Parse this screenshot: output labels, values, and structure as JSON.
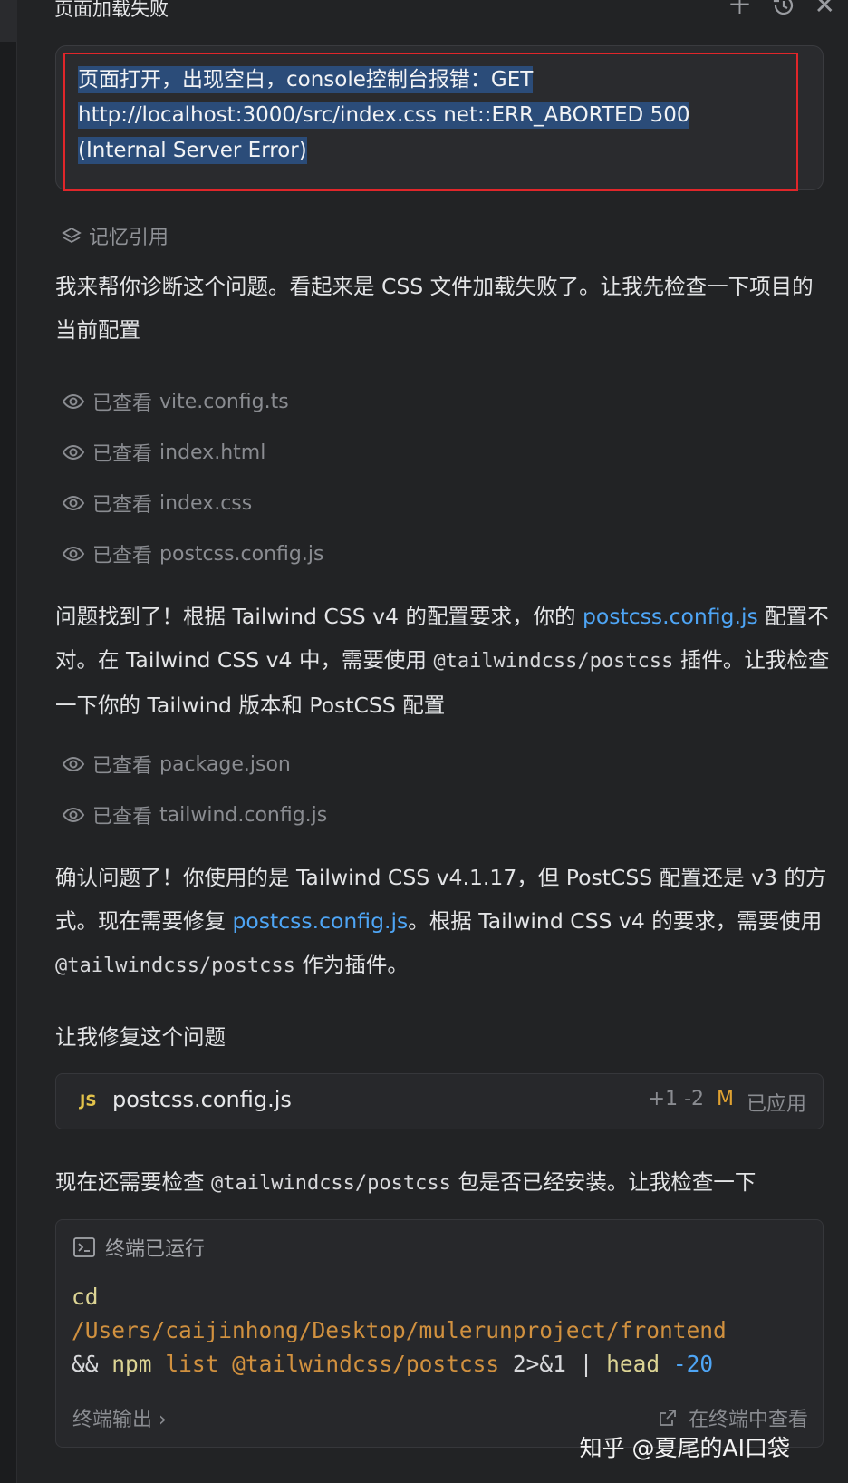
{
  "header": {
    "title": "页面加载失败",
    "icons": [
      "plus-icon",
      "history-icon",
      "close-icon"
    ]
  },
  "query": {
    "line1": "页面打开，出现空白，console控制台报错：GET",
    "line2": "http://localhost:3000/src/index.css net::ERR_ABORTED 500",
    "line3": "(Internal Server Error)"
  },
  "memory_label": "记忆引用",
  "para1": "我来帮你诊断这个问题。看起来是 CSS 文件加载失败了。让我先检查一下项目的当前配置",
  "viewed_prefix": "已查看",
  "viewed_group1": [
    "vite.config.ts",
    "index.html",
    "index.css",
    "postcss.config.js"
  ],
  "para2": {
    "a": "问题找到了！根据 Tailwind CSS v4 的配置要求，你的 ",
    "link": "postcss.config.js",
    "b": " 配置不对。在 Tailwind CSS v4 中，需要使用 ",
    "code": "@tailwindcss/postcss",
    "c": " 插件。让我检查一下你的 Tailwind 版本和 PostCSS 配置"
  },
  "viewed_group2": [
    "package.json",
    "tailwind.config.js"
  ],
  "para3": {
    "a": "确认问题了！你使用的是 Tailwind CSS v4.1.17，但 PostCSS 配置还是 v3 的方式。现在需要修复 ",
    "link": "postcss.config.js",
    "b": "。根据 Tailwind CSS v4 的要求，需要使用 ",
    "code": "@tailwindcss/postcss",
    "c": " 作为插件。"
  },
  "para4": "让我修复这个问题",
  "file_card": {
    "badge": "JS",
    "name": "postcss.config.js",
    "diff": "+1 -2",
    "mark": "M",
    "status": "已应用"
  },
  "para5": {
    "a": "现在还需要检查 ",
    "code": "@tailwindcss/postcss",
    "b": " 包是否已经安装。让我检查一下"
  },
  "terminal": {
    "title": "终端已运行",
    "cmd": "cd",
    "path": "/Users/caijinhong/Desktop/mulerunproject/frontend",
    "and": "&&",
    "npm": "npm",
    "list": "list @tailwindcss/postcss",
    "redir": "2>&1 |",
    "head": "head",
    "num": "-20",
    "output_label": "终端输出 ›",
    "view_label": "在终端中查看"
  },
  "watermark": "知乎 @夏尾的AI口袋",
  "colors": {
    "background": "#222325",
    "link": "#4ea5f5",
    "highlight": "#2b4c79",
    "red_frame": "#e0262a",
    "mark": "#e0a232"
  }
}
